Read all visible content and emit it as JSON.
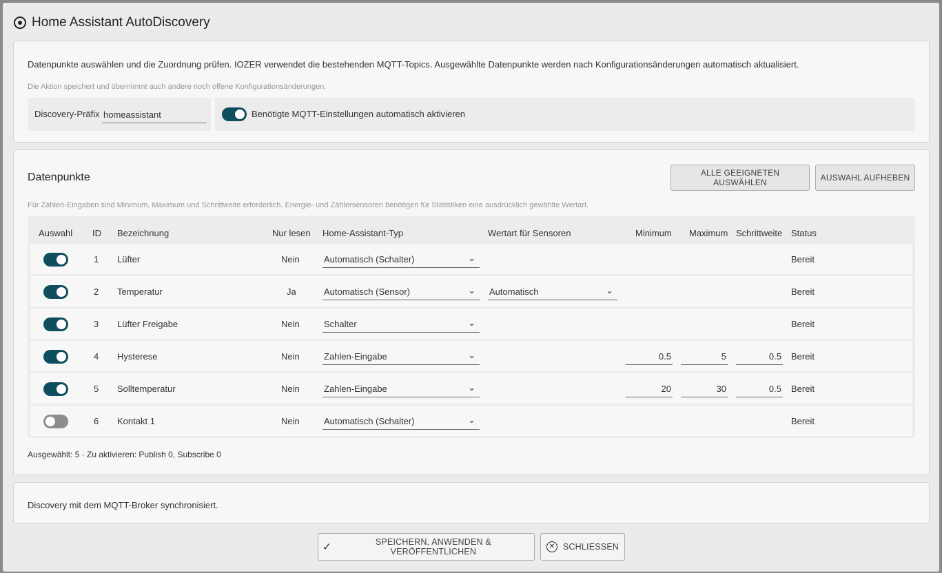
{
  "dialog": {
    "title": "Home Assistant AutoDiscovery",
    "description": "Datenpunkte auswählen und die Zuordnung prüfen. IOZER verwendet die bestehenden MQTT-Topics. Ausgewählte Datenpunkte werden nach Konfigurationsänderungen automatisch aktualisiert.",
    "note": "Die Aktion speichert und übernimmt auch andere noch offene Konfigurationsänderungen.",
    "prefix_label": "Discovery-Präfix",
    "prefix_value": "homeassistant",
    "auto_mqtt_label": "Benötigte MQTT-Einstellungen automatisch aktivieren",
    "auto_mqtt_on": true
  },
  "datapoints": {
    "title": "Datenpunkte",
    "select_all_label": "ALLE GEEIGNETEN AUSWÄHLEN",
    "clear_label": "AUSWAHL AUFHEBEN",
    "hint": "Für Zahlen-Eingaben sind Minimum, Maximum und Schrittweite erforderlich. Energie- und Zählersensoren benötigen für Statistiken eine ausdrücklich gewählte Wertart.",
    "headers": {
      "select": "Auswahl",
      "id": "ID",
      "name": "Bezeichnung",
      "readonly": "Nur lesen",
      "ha_type": "Home-Assistant-Typ",
      "value_kind": "Wertart für Sensoren",
      "min": "Minimum",
      "max": "Maximum",
      "step": "Schrittweite",
      "status": "Status"
    },
    "rows": [
      {
        "selected": true,
        "id": "1",
        "name": "Lüfter",
        "readonly": "Nein",
        "ha_type": "Automatisch (Schalter)",
        "value_kind": "",
        "min": "",
        "max": "",
        "step": "",
        "status": "Bereit"
      },
      {
        "selected": true,
        "id": "2",
        "name": "Temperatur",
        "readonly": "Ja",
        "ha_type": "Automatisch (Sensor)",
        "value_kind": "Automatisch",
        "min": "",
        "max": "",
        "step": "",
        "status": "Bereit"
      },
      {
        "selected": true,
        "id": "3",
        "name": "Lüfter Freigabe",
        "readonly": "Nein",
        "ha_type": "Schalter",
        "value_kind": "",
        "min": "",
        "max": "",
        "step": "",
        "status": "Bereit"
      },
      {
        "selected": true,
        "id": "4",
        "name": "Hysterese",
        "readonly": "Nein",
        "ha_type": "Zahlen-Eingabe",
        "value_kind": "",
        "min": "0.5",
        "max": "5",
        "step": "0.5",
        "status": "Bereit"
      },
      {
        "selected": true,
        "id": "5",
        "name": "Solltemperatur",
        "readonly": "Nein",
        "ha_type": "Zahlen-Eingabe",
        "value_kind": "",
        "min": "20",
        "max": "30",
        "step": "0.5",
        "status": "Bereit"
      },
      {
        "selected": false,
        "id": "6",
        "name": "Kontakt 1",
        "readonly": "Nein",
        "ha_type": "Automatisch (Schalter)",
        "value_kind": "",
        "min": "",
        "max": "",
        "step": "",
        "status": "Bereit"
      }
    ],
    "summary": "Ausgewählt: 5 · Zu aktivieren: Publish 0, Subscribe 0"
  },
  "sync_status": "Discovery mit dem MQTT-Broker synchronisiert.",
  "footer": {
    "save_label": "SPEICHERN, ANWENDEN & VERÖFFENTLICHEN",
    "close_label": "SCHLIESSEN"
  },
  "icons": {
    "title": "radio-target-icon",
    "save": "check-icon",
    "close": "close-circle-icon",
    "dropdown": "chevron-down-icon"
  },
  "colors": {
    "accent": "#0f4e5e",
    "toggle_off": "#8d8d8d"
  }
}
